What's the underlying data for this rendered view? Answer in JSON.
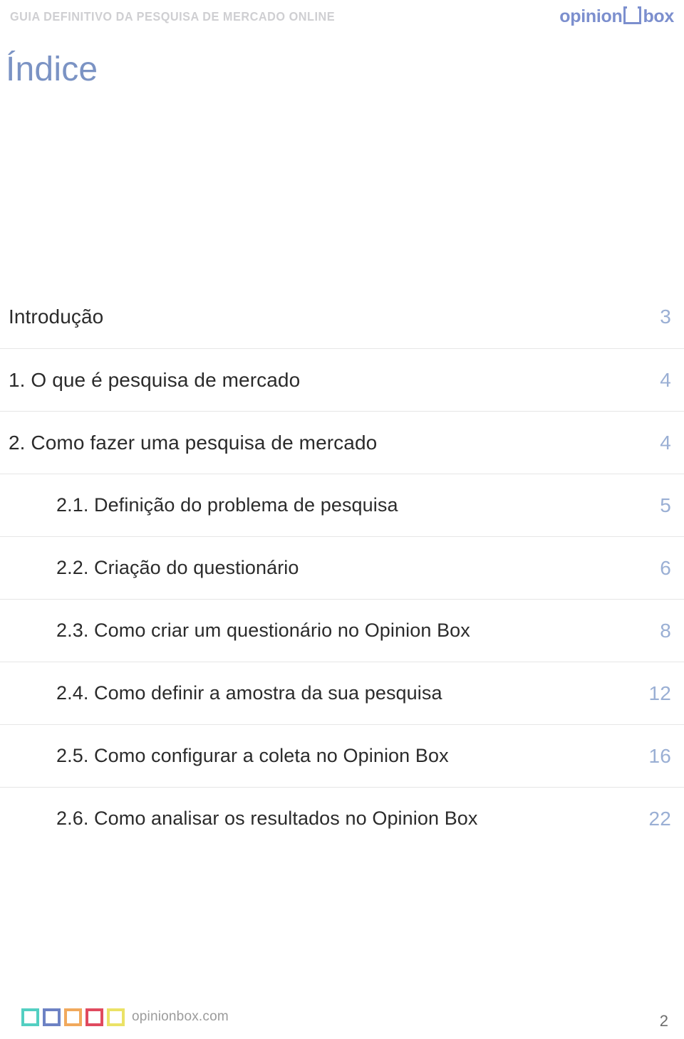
{
  "header": {
    "kicker": "GUIA DEFINITIVO DA PESQUISA DE MERCADO ONLINE",
    "logo": {
      "word_left": "opinion",
      "word_right": "box",
      "icon": "square-outline-icon",
      "color": "#7c8fce"
    }
  },
  "title": "Índice",
  "toc": {
    "entries": [
      {
        "label": "Introdução",
        "page": "3",
        "level": 1
      },
      {
        "label": "1. O que é pesquisa de mercado",
        "page": "4",
        "level": 1
      },
      {
        "label": "2. Como fazer uma pesquisa de mercado",
        "page": "4",
        "level": 1
      },
      {
        "label": "2.1. Definição do problema de pesquisa",
        "page": "5",
        "level": 2
      },
      {
        "label": "2.2. Criação do questionário",
        "page": "6",
        "level": 2
      },
      {
        "label": "2.3. Como criar um questionário no Opinion Box",
        "page": "8",
        "level": 2
      },
      {
        "label": "2.4. Como definir a amostra da sua pesquisa",
        "page": "12",
        "level": 2
      },
      {
        "label": "2.5. Como configurar a coleta no Opinion Box",
        "page": "16",
        "level": 2
      },
      {
        "label": "2.6. Como analisar os resultados no Opinion Box",
        "page": "22",
        "level": 2
      }
    ]
  },
  "footer": {
    "url": "opinionbox.com",
    "page_number": "2",
    "marks": [
      {
        "name": "square-mark-teal",
        "color": "#53cfc2"
      },
      {
        "name": "square-mark-blue",
        "color": "#6d82c4"
      },
      {
        "name": "square-mark-orange",
        "color": "#f1a95c"
      },
      {
        "name": "square-mark-red",
        "color": "#e04a5f"
      },
      {
        "name": "square-mark-yellow",
        "color": "#ebe266"
      }
    ]
  },
  "colors": {
    "title": "#7b93c4",
    "page_number_accent": "#9aafd4",
    "kicker": "#cfcfd2",
    "rule": "#e6e6e6"
  }
}
